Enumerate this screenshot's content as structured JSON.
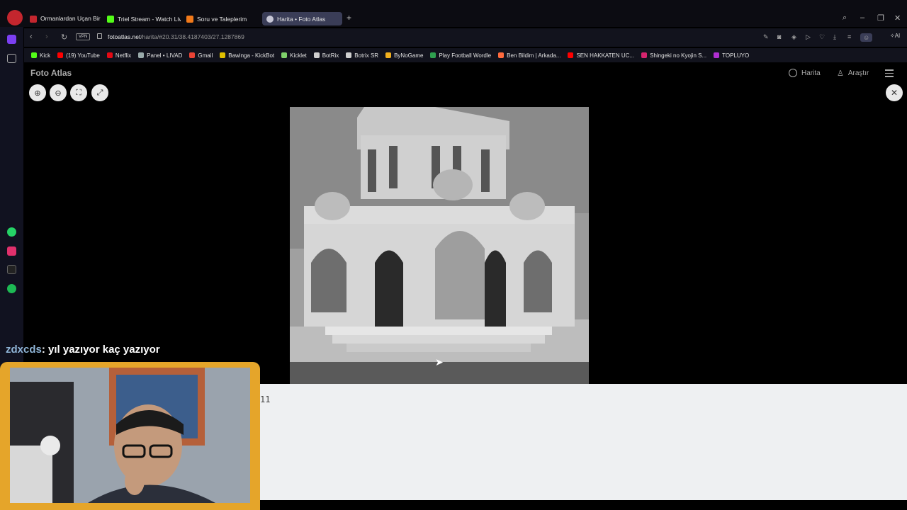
{
  "browser": {
    "tabs": [
      {
        "label": "Ormanlardan Uçan Bir Kuş Gibi — ✦ ✦ ✦",
        "icon": "opera-gx-icon",
        "color": "#c4262e"
      },
      {
        "label": "Triel Stream - Watch Live c",
        "icon": "kick-icon",
        "color": "#53fc18"
      },
      {
        "label": "Soru ve Taleplerim",
        "icon": "hb-icon",
        "color": "#f27a1a"
      },
      {
        "label": "Harita • Foto Atlas",
        "icon": "fotoatlas-icon",
        "color": "#c7c7d6"
      }
    ],
    "new_tab_label": "+",
    "address": {
      "vpn_label": "VPN",
      "domain": "fotoatlas.net",
      "path": "/harita/#20.31/38.4187403/27.1287869"
    },
    "ai_label": "AI",
    "bookmarks": [
      {
        "label": "Kick",
        "color": "#53fc18"
      },
      {
        "label": "(19) YouTube",
        "color": "#ff0000"
      },
      {
        "label": "Netflix",
        "color": "#e50914"
      },
      {
        "label": "Panel • LIVAD",
        "color": "#9aa"
      },
      {
        "label": "Gmail",
        "color": "#ea4335"
      },
      {
        "label": "Bawinga - KickBot",
        "color": "#e0c000"
      },
      {
        "label": "Kicklet",
        "color": "#7fd16b"
      },
      {
        "label": "BotRix",
        "color": "#cfcfcf"
      },
      {
        "label": "Botrix SR",
        "color": "#cfcfcf"
      },
      {
        "label": "ByNoGame",
        "color": "#f2b01e"
      },
      {
        "label": "Play Football Wordle",
        "color": "#2fa04f"
      },
      {
        "label": "Ben Bildim | Arkada...",
        "color": "#ff6a3d"
      },
      {
        "label": "SEN HAKKATEN UC...",
        "color": "#ff0000"
      },
      {
        "label": "Shingeki no Kyojin S...",
        "color": "#d6246e"
      },
      {
        "label": "TOPLUYO",
        "color": "#b02fd1"
      }
    ]
  },
  "page": {
    "site_title": "Foto Atlas",
    "nav": {
      "map_label": "Harita",
      "explore_label": "Araştır"
    },
    "panel_text": "11"
  },
  "overlay": {
    "chat_user": "zdxcds",
    "chat_message": ": yıl yazıyor kaç yazıyor"
  }
}
